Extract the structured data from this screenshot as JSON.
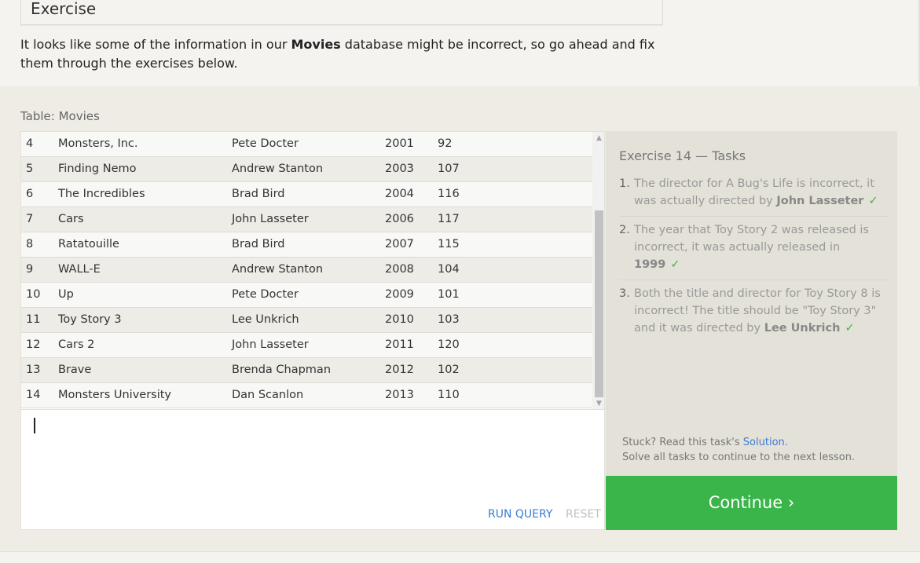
{
  "header": {
    "exercise_title": "Exercise",
    "intro_pre": "It looks like some of the information in our ",
    "intro_bold": "Movies",
    "intro_post": " database might be incorrect, so go ahead and fix them through the exercises below."
  },
  "table": {
    "caption": "Table: Movies",
    "rows": [
      {
        "id": "4",
        "title": "Monsters, Inc.",
        "director": "Pete Docter",
        "year": "2001",
        "length": "92"
      },
      {
        "id": "5",
        "title": "Finding Nemo",
        "director": "Andrew Stanton",
        "year": "2003",
        "length": "107"
      },
      {
        "id": "6",
        "title": "The Incredibles",
        "director": "Brad Bird",
        "year": "2004",
        "length": "116"
      },
      {
        "id": "7",
        "title": "Cars",
        "director": "John Lasseter",
        "year": "2006",
        "length": "117"
      },
      {
        "id": "8",
        "title": "Ratatouille",
        "director": "Brad Bird",
        "year": "2007",
        "length": "115"
      },
      {
        "id": "9",
        "title": "WALL-E",
        "director": "Andrew Stanton",
        "year": "2008",
        "length": "104"
      },
      {
        "id": "10",
        "title": "Up",
        "director": "Pete Docter",
        "year": "2009",
        "length": "101"
      },
      {
        "id": "11",
        "title": "Toy Story 3",
        "director": "Lee Unkrich",
        "year": "2010",
        "length": "103"
      },
      {
        "id": "12",
        "title": "Cars 2",
        "director": "John Lasseter",
        "year": "2011",
        "length": "120"
      },
      {
        "id": "13",
        "title": "Brave",
        "director": "Brenda Chapman",
        "year": "2012",
        "length": "102"
      },
      {
        "id": "14",
        "title": "Monsters University",
        "director": "Dan Scanlon",
        "year": "2013",
        "length": "110"
      }
    ]
  },
  "editor": {
    "value": "",
    "run_label": "RUN QUERY",
    "reset_label": "RESET"
  },
  "tasks": {
    "title": "Exercise 14 — Tasks",
    "items": [
      {
        "num": "1.",
        "text": "The director for A Bug's Life is incorrect, it was actually directed by ",
        "bold": "John Lasseter",
        "check": "✓"
      },
      {
        "num": "2.",
        "text": "The year that Toy Story 2 was released is incorrect, it was actually released in ",
        "bold": "1999",
        "check": "✓"
      },
      {
        "num": "3.",
        "text": "Both the title and director for Toy Story 8 is incorrect! The title should be \"Toy Story 3\" and it was directed by ",
        "bold": "Lee Unkrich",
        "check": "✓"
      }
    ],
    "stuck_prefix": "Stuck? Read this task's ",
    "solution_link": "Solution.",
    "solve_all": "Solve all tasks to continue to the next lesson."
  },
  "continue_label": "Continue ›",
  "colors": {
    "accent_green": "#3ab54a",
    "link_blue": "#3a7bd5",
    "check_green": "#4ab04a"
  },
  "icons": {
    "scroll_up": "scroll-up-arrow-icon",
    "scroll_down": "scroll-down-arrow-icon",
    "check": "check-icon"
  }
}
